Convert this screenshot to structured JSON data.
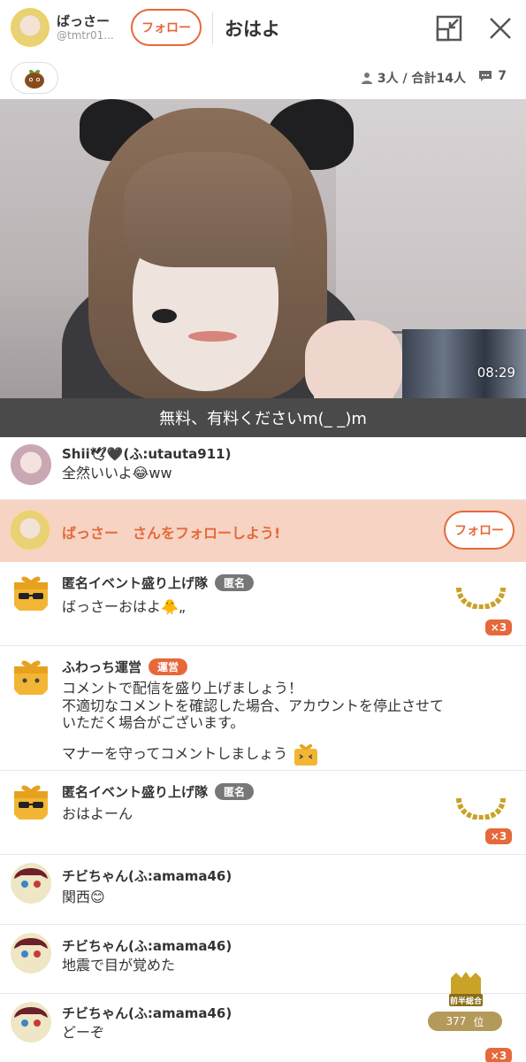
{
  "header": {
    "user_name": "ばっさー",
    "user_id": "@tmtr01...",
    "follow_label": "フォロー",
    "title": "おはよ"
  },
  "stats": {
    "viewers": "3人 / 合計14人",
    "comments": "7"
  },
  "video": {
    "elapsed": "08:29",
    "caption": "無料、有料くださいm(_ _)m"
  },
  "comments": [
    {
      "name": "Shii🕊🖤(ふ:utauta911)",
      "text": "全然いいよ😂ww"
    },
    {
      "name": "匿名イベント盛り上げ隊",
      "tag": "匿名",
      "text": "ばっさーおはよ🐥„",
      "count": "×3"
    },
    {
      "name": "ふわっち運営",
      "tag": "運営",
      "text": "コメントで配信を盛り上げましょう！",
      "text2": "不適切なコメントを確認した場合、アカウントを停止させて",
      "text3": "いただく場合がございます。",
      "text4": "マナーを守ってコメントしましょう"
    },
    {
      "name": "匿名イベント盛り上げ隊",
      "tag": "匿名",
      "text": "おはよーん",
      "count": "×3"
    },
    {
      "name": "チビちゃん(ふ:amama46)",
      "text": "関西😊"
    },
    {
      "name": "チビちゃん(ふ:amama46)",
      "text": "地震で目が覚めた"
    },
    {
      "name": "チビちゃん(ふ:amama46)",
      "text": "どーぞ",
      "count": "×3"
    }
  ],
  "follow_banner": {
    "text": "ばっさー　さんをフォローしよう!",
    "button": "フォロー"
  },
  "rank": {
    "label": "前半総合",
    "value": "377",
    "unit": "位"
  },
  "colors": {
    "accent": "#e5693a",
    "banner_bg": "#f6d3c2",
    "caption_bg": "#4a4a4a"
  }
}
